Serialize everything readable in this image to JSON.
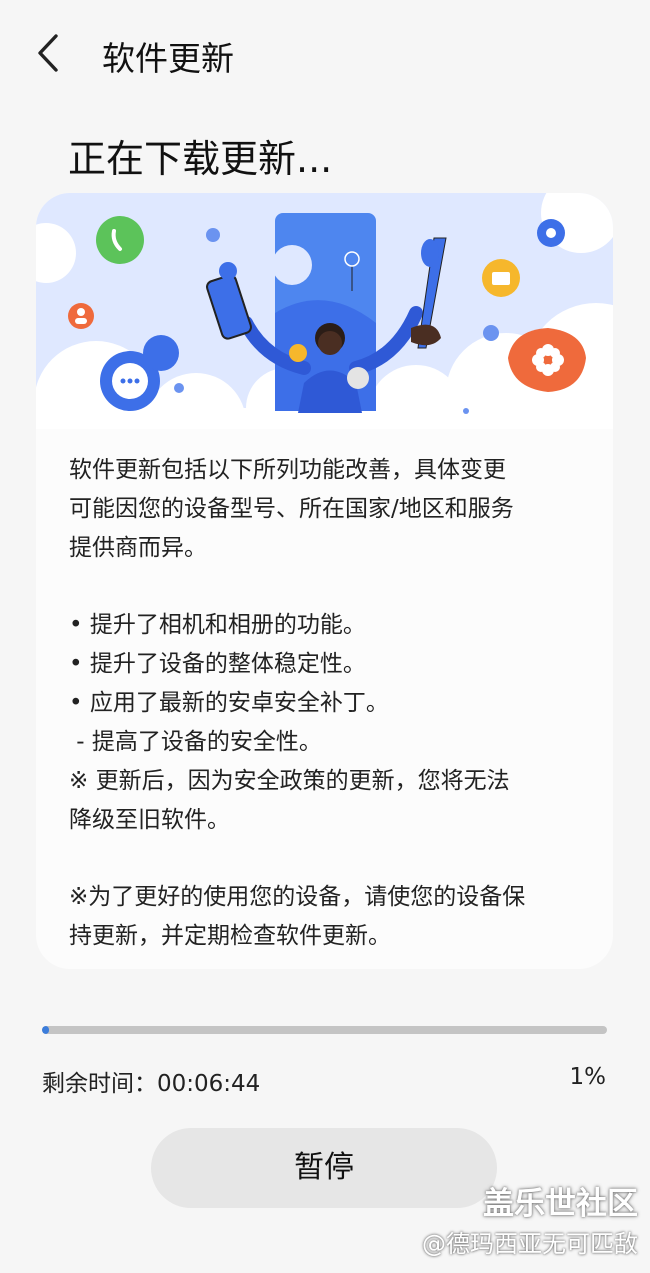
{
  "header": {
    "title": "软件更新",
    "back_icon": "chevron-left-icon"
  },
  "status": {
    "title": "正在下载更新..."
  },
  "illustration": {
    "icons": [
      "phone-icon",
      "user-icon",
      "chat-icon",
      "settings-icon",
      "folder-icon",
      "flower-icon"
    ],
    "colors": {
      "sky": "#dfe8ff",
      "accent_blue": "#3d6fe8",
      "orange": "#ef6a3c",
      "green": "#5cc35a",
      "yellow": "#f6b72c"
    }
  },
  "description": {
    "intro": [
      "软件更新包括以下所列功能改善，具体变更",
      "可能因您的设备型号、所在国家/地区和服务",
      "提供商而异。"
    ],
    "items": [
      "• 提升了相机和相册的功能。",
      "• 提升了设备的整体稳定性。",
      "• 应用了最新的安卓安全补丁。",
      " - 提高了设备的安全性。"
    ],
    "notice": [
      "※ 更新后，因为安全政策的更新，您将无法",
      "降级至旧软件。"
    ],
    "footer": [
      "※为了更好的使用您的设备，请使您的设备保",
      "持更新，并定期检查软件更新。"
    ]
  },
  "progress": {
    "value_fraction": 0.01,
    "time_label": "剩余时间：",
    "time_value": "00:06:44",
    "percent_text": "1%",
    "fill_color": "#3b7ddb"
  },
  "actions": {
    "pause_label": "暂停"
  },
  "watermark": {
    "brand": "盖乐世社区",
    "user": "@德玛西亚无可匹敌"
  }
}
